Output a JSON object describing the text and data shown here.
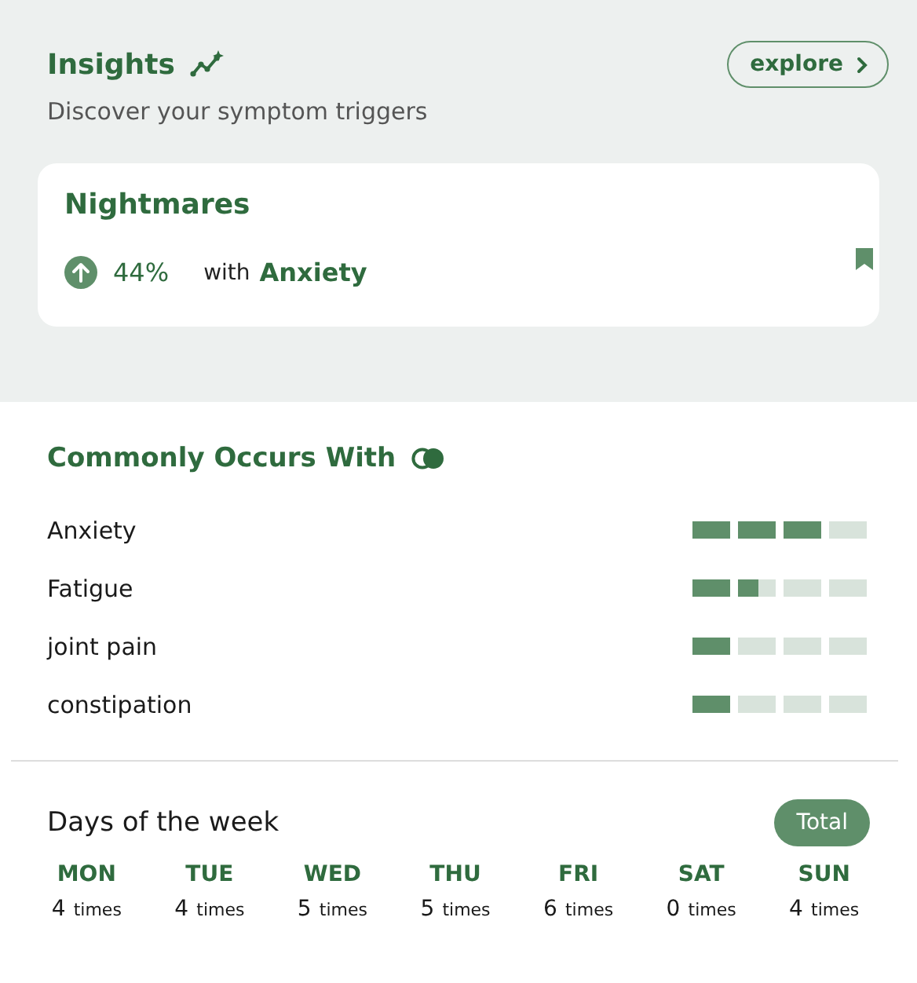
{
  "insights": {
    "title": "Insights",
    "subtitle": "Discover your symptom triggers",
    "explore_button": "explore",
    "card": {
      "symptom": "Nightmares",
      "increase": true,
      "percent": "44%",
      "with_label": "with",
      "related": "Anxiety"
    }
  },
  "commonly_occurs": {
    "title": "Commonly Occurs With",
    "items": [
      {
        "name": "Anxiety",
        "level": 0.75
      },
      {
        "name": "Fatigue",
        "level": 0.375
      },
      {
        "name": "joint pain",
        "level": 0.25
      },
      {
        "name": "constipation",
        "level": 0.25
      }
    ]
  },
  "days_of_week": {
    "title": "Days of the week",
    "toggle": "Total",
    "days": [
      {
        "day": "MON",
        "count": "4",
        "unit": "times"
      },
      {
        "day": "TUE",
        "count": "4",
        "unit": "times"
      },
      {
        "day": "WED",
        "count": "5",
        "unit": "times"
      },
      {
        "day": "THU",
        "count": "5",
        "unit": "times"
      },
      {
        "day": "FRI",
        "count": "6",
        "unit": "times"
      },
      {
        "day": "SAT",
        "count": "0",
        "unit": "times"
      },
      {
        "day": "SUN",
        "count": "4",
        "unit": "times"
      }
    ]
  }
}
